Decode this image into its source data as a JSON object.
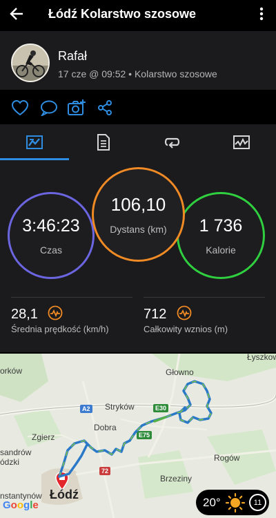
{
  "appbar": {
    "title": "Łódź Kolarstwo szosowe"
  },
  "header": {
    "username": "Rafał",
    "meta": "17 cze @ 09:52 • Kolarstwo szosowe"
  },
  "stats": {
    "czas": {
      "value": "3:46:23",
      "label": "Czas"
    },
    "dystans": {
      "value": "106,10",
      "label": "Dystans (km)"
    },
    "kalorie": {
      "value": "1 736",
      "label": "Kalorie"
    }
  },
  "metrics": {
    "speed": {
      "value": "28,1",
      "label": "Średnia prędkość (km/h)"
    },
    "ascent": {
      "value": "712",
      "label": "Całkowity wznios (m)"
    }
  },
  "map": {
    "labels": {
      "lyszkowice": "Łyszkowice",
      "glowno": "Głowno",
      "orkow": "orków",
      "strykow": "Stryków",
      "dobra": "Dobra",
      "zgierz": "Zgierz",
      "sandrow": "sandrów",
      "odzki": "ódzki",
      "rogow": "Rogów",
      "brzeziny": "Brzeziny",
      "konstantynow": "nstantynów",
      "lodz": "Łódź",
      "google": "Google"
    },
    "roads": {
      "a2": "A2",
      "e30": "E30",
      "e75": "E75",
      "r72": "72"
    }
  },
  "weather": {
    "temp": "20°",
    "badge": "11"
  },
  "colors": {
    "accent": "#2e8de0",
    "czas": "#6b65e0",
    "dystans": "#f08a24",
    "kalorie": "#2fcf3f",
    "pin": "#e3262c",
    "route": "#2a78c8"
  }
}
